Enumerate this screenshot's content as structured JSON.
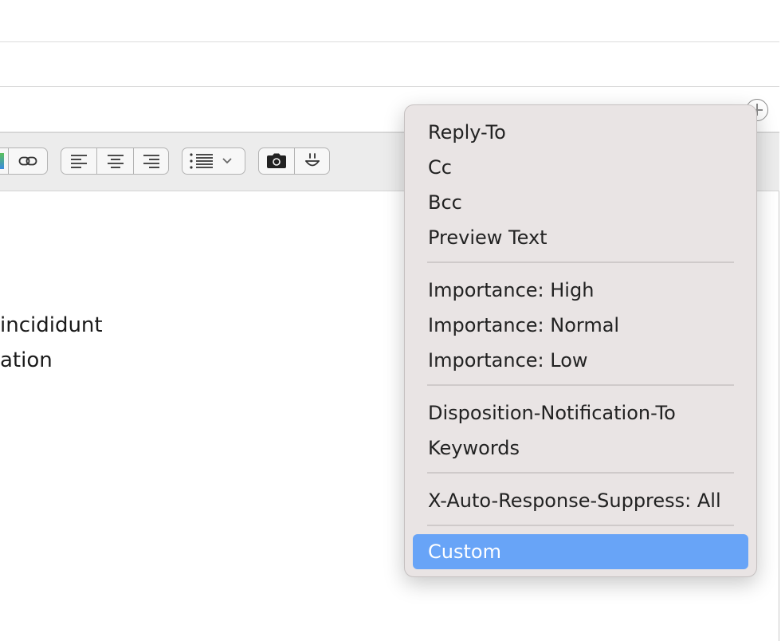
{
  "editor": {
    "body_line_1": "incididunt",
    "body_line_2": "ation"
  },
  "toolbar": {
    "groups": [
      "link-group",
      "alignment-group",
      "list-group",
      "insert-group"
    ]
  },
  "menu": {
    "items": [
      {
        "label": "Reply-To"
      },
      {
        "label": "Cc"
      },
      {
        "label": "Bcc"
      },
      {
        "label": "Preview Text"
      },
      {
        "label": "Importance: High"
      },
      {
        "label": "Importance: Normal"
      },
      {
        "label": "Importance: Low"
      },
      {
        "label": "Disposition-Notification-To"
      },
      {
        "label": "Keywords"
      },
      {
        "label": "X-Auto-Response-Suppress: All"
      },
      {
        "label": "Custom"
      }
    ],
    "selected": "Custom"
  },
  "colors": {
    "menu_background": "#e9e4e4",
    "selection": "#68a4f7",
    "toolbar_background": "#ececec"
  }
}
